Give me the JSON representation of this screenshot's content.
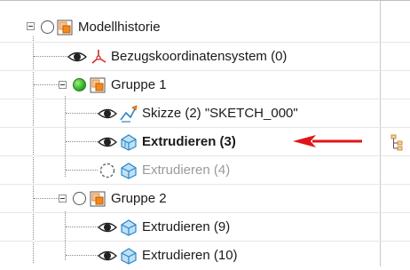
{
  "tree": {
    "items": [
      {
        "label": "Modellhistorie"
      },
      {
        "label": "Bezugskoordinatensystem (0)"
      },
      {
        "label": "Gruppe 1"
      },
      {
        "label": "Skizze (2) \"SKETCH_000\""
      },
      {
        "label": "Extrudieren (3)"
      },
      {
        "label": "Extrudieren (4)"
      },
      {
        "label": "Gruppe 2"
      },
      {
        "label": "Extrudieren (9)"
      },
      {
        "label": "Extrudieren (10)"
      }
    ]
  },
  "colors": {
    "arrow": "#e0141a",
    "group_icon": "#f08a1c",
    "feature_icon": "#2a86c9",
    "active_state": "#38b52a"
  },
  "icons": {
    "visibility": "eye-icon",
    "group": "group-folder-icon",
    "coordinate_system": "coordinate-system-icon",
    "sketch": "sketch-icon",
    "extrude": "extrude-icon"
  }
}
